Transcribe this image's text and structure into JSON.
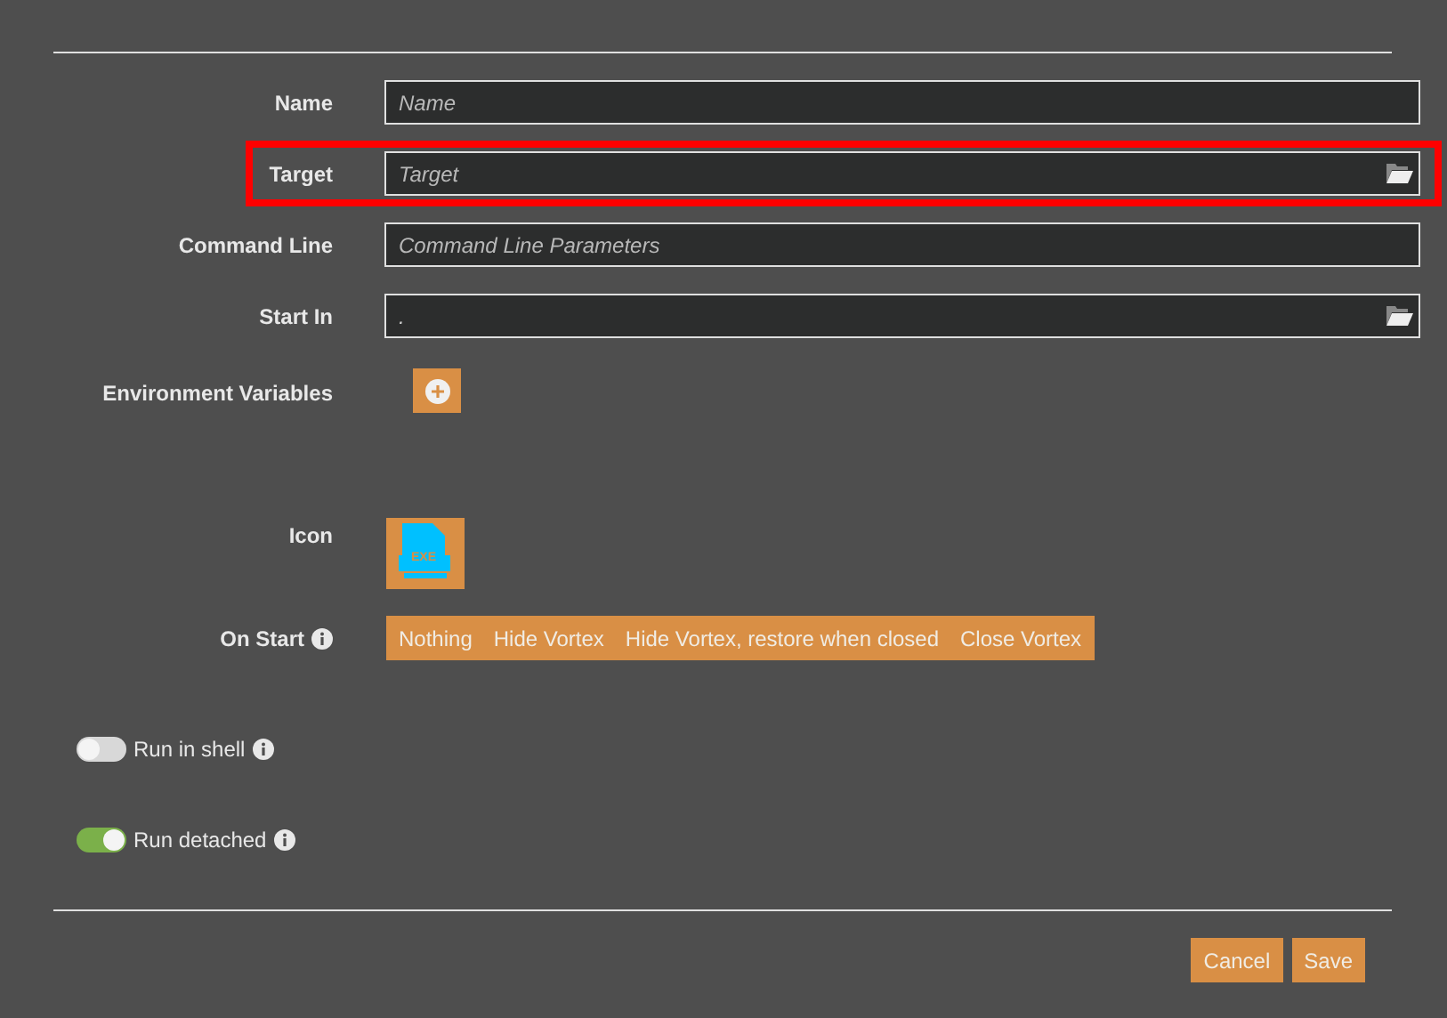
{
  "fields": [
    {
      "label": "Name",
      "placeholder": "Name",
      "browse": false,
      "highlighted": false
    },
    {
      "label": "Target",
      "placeholder": "Target",
      "browse": true,
      "highlighted": true
    },
    {
      "label": "Command Line",
      "placeholder": "Command Line Parameters",
      "browse": false,
      "highlighted": false
    },
    {
      "label": "Start In",
      "value": ".",
      "browse": true,
      "highlighted": false
    }
  ],
  "environment": {
    "label": "Environment Variables"
  },
  "icon": {
    "label": "Icon",
    "badge": "EXE"
  },
  "on_start": {
    "label": "On Start",
    "options": [
      {
        "label": "Nothing",
        "selected": false
      },
      {
        "label": "Hide Vortex",
        "selected": false
      },
      {
        "label": "Hide Vortex, restore when closed",
        "selected": false
      },
      {
        "label": "Close Vortex",
        "selected": false
      }
    ]
  },
  "toggles": [
    {
      "label": "Run in shell",
      "on": false
    },
    {
      "label": "Run detached",
      "on": true
    }
  ],
  "buttons": [
    "Cancel",
    "Save"
  ]
}
